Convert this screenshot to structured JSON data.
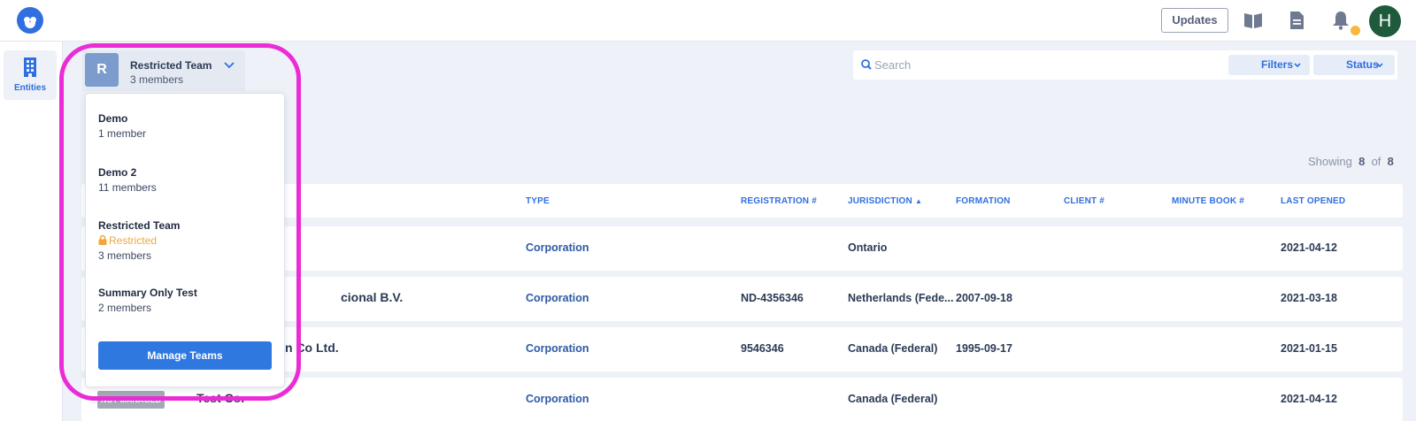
{
  "topbar": {
    "updates_label": "Updates",
    "avatar_initial": "H",
    "accent": "#2f6fe0",
    "notification_dot_color": "#f6b93b"
  },
  "sidenav": {
    "entities_label": "Entities"
  },
  "team_selector": {
    "initial": "R",
    "name": "Restricted Team",
    "members": "3 members"
  },
  "dropdown": {
    "items": [
      {
        "name": "Demo",
        "members": "1 member"
      },
      {
        "name": "Demo 2",
        "members": "11 members"
      },
      {
        "name": "Restricted Team",
        "restricted": "Restricted",
        "members": "3 members"
      },
      {
        "name": "Summary Only Test",
        "members": "2 members"
      }
    ],
    "manage_label": "Manage Teams"
  },
  "search": {
    "placeholder": "Search",
    "value": ""
  },
  "filters": {
    "filters_label": "Filters",
    "status_label": "Status"
  },
  "showing": {
    "prefix": "Showing",
    "count": "8",
    "of": "of",
    "total": "8"
  },
  "table": {
    "columns": {
      "type": "TYPE",
      "registration": "REGISTRATION #",
      "jurisdiction": "JURISDICTION",
      "formation": "FORMATION",
      "client": "CLIENT #",
      "minute_book": "MINUTE BOOK #",
      "last_opened": "LAST OPENED"
    },
    "rows": [
      {
        "name": "",
        "type": "Corporation",
        "registration": "",
        "jurisdiction": "Ontario",
        "formation": "",
        "client": "",
        "minute_book": "",
        "last_opened": "2021-04-12"
      },
      {
        "name": "cional B.V.",
        "type": "Corporation",
        "registration": "ND-4356346",
        "jurisdiction": "Netherlands (Fede...",
        "formation": "2007-09-18",
        "client": "",
        "minute_book": "",
        "last_opened": "2021-03-18"
      },
      {
        "name": "n Co Ltd.",
        "type": "Corporation",
        "registration": "9546346",
        "jurisdiction": "Canada (Federal)",
        "formation": "1995-09-17",
        "client": "",
        "minute_book": "",
        "last_opened": "2021-01-15"
      },
      {
        "badge": "NOT MANAGED",
        "name": "Test Co.",
        "type": "Corporation",
        "registration": "",
        "jurisdiction": "Canada (Federal)",
        "formation": "",
        "client": "",
        "minute_book": "",
        "last_opened": "2021-04-12"
      }
    ]
  },
  "annotation": {
    "highlight_color": "#ea2bd6"
  }
}
